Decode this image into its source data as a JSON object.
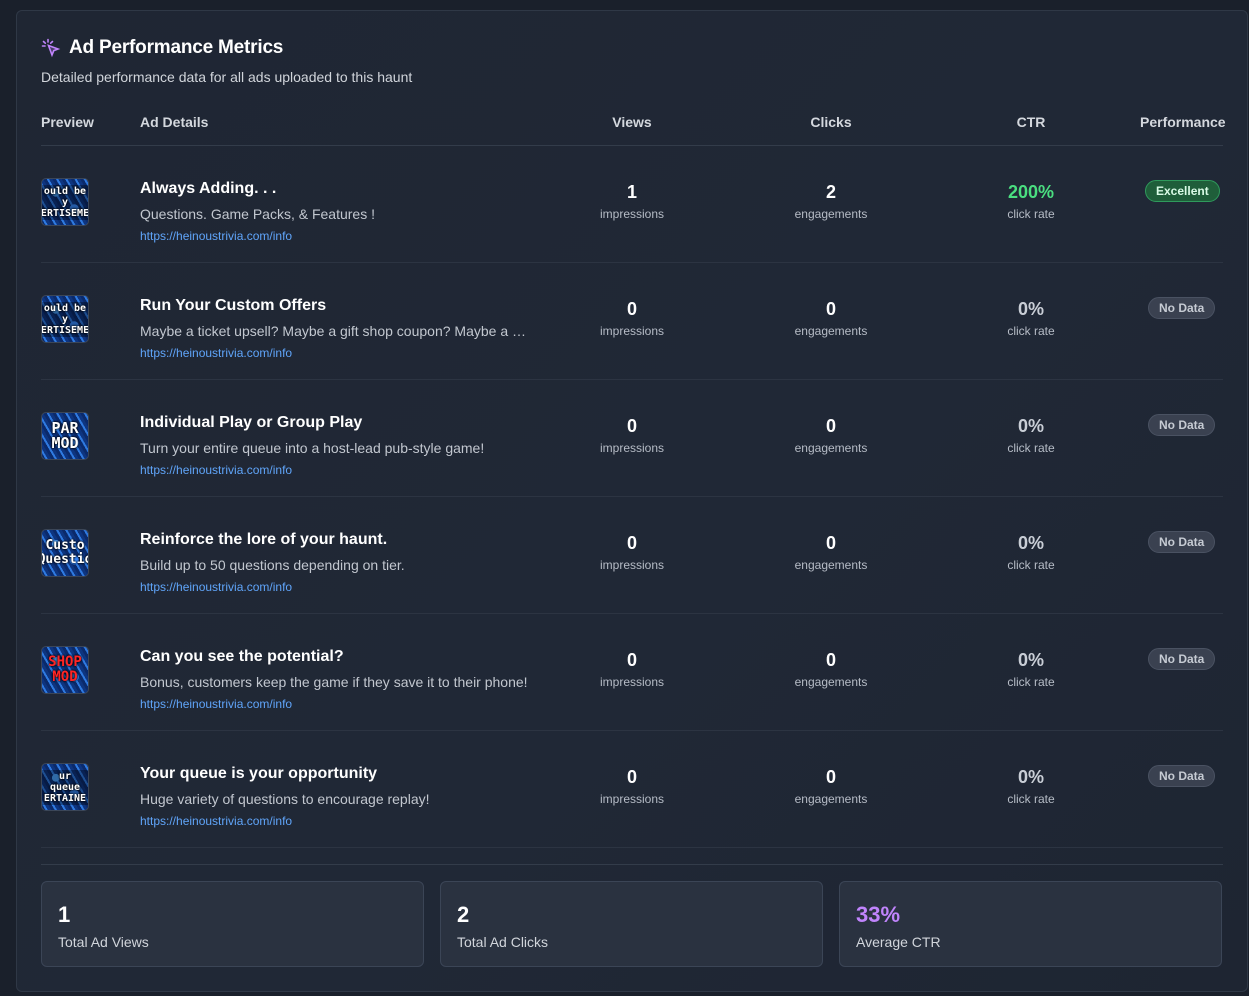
{
  "header": {
    "title": "Ad Performance Metrics",
    "subtitle": "Detailed performance data for all ads uploaded to this haunt",
    "icon": "sparkle-cursor-icon",
    "accent": "#c084fc"
  },
  "table": {
    "columns": [
      "Preview",
      "Ad Details",
      "Views",
      "Clicks",
      "CTR",
      "Performance"
    ],
    "rows": [
      {
        "thumb_text": "ould be y\nERTISEME",
        "title": "Always Adding. . .",
        "description": "Questions. Game Packs, & Features !",
        "link": "https://heinoustrivia.com/info",
        "views": "1",
        "views_label": "impressions",
        "clicks": "2",
        "clicks_label": "engagements",
        "ctr": "200%",
        "ctr_label": "click rate",
        "performance": "Excellent"
      },
      {
        "thumb_text": "ould be y\nERTISEME",
        "title": "Run Your Custom Offers",
        "description": "Maybe a ticket upsell? Maybe a gift shop coupon? Maybe a raffle?",
        "link": "https://heinoustrivia.com/info",
        "views": "0",
        "views_label": "impressions",
        "clicks": "0",
        "clicks_label": "engagements",
        "ctr": "0%",
        "ctr_label": "click rate",
        "performance": "No Data"
      },
      {
        "thumb_text": "PAR\nMOD",
        "title": "Individual Play or Group Play",
        "description": "Turn your entire queue into a host-lead pub-style game!",
        "link": "https://heinoustrivia.com/info",
        "views": "0",
        "views_label": "impressions",
        "clicks": "0",
        "clicks_label": "engagements",
        "ctr": "0%",
        "ctr_label": "click rate",
        "performance": "No Data"
      },
      {
        "thumb_text": "Custo\nQuestio",
        "title": "Reinforce the lore of your haunt.",
        "description": "Build up to 50 questions depending on tier.",
        "link": "https://heinoustrivia.com/info",
        "views": "0",
        "views_label": "impressions",
        "clicks": "0",
        "clicks_label": "engagements",
        "ctr": "0%",
        "ctr_label": "click rate",
        "performance": "No Data"
      },
      {
        "thumb_text": "SHOP\nMOD",
        "title": "Can you see the potential?",
        "description": "Bonus, customers keep the game if they save it to their phone!",
        "link": "https://heinoustrivia.com/info",
        "views": "0",
        "views_label": "impressions",
        "clicks": "0",
        "clicks_label": "engagements",
        "ctr": "0%",
        "ctr_label": "click rate",
        "performance": "No Data"
      },
      {
        "thumb_text": "ur queue\nERTAINE",
        "title": "Your queue is your opportunity",
        "description": "Huge variety of questions to encourage replay!",
        "link": "https://heinoustrivia.com/info",
        "views": "0",
        "views_label": "impressions",
        "clicks": "0",
        "clicks_label": "engagements",
        "ctr": "0%",
        "ctr_label": "click rate",
        "performance": "No Data"
      }
    ]
  },
  "summary": {
    "views_value": "1",
    "views_label": "Total Ad Views",
    "clicks_value": "2",
    "clicks_label": "Total Ad Clicks",
    "ctr_value": "33%",
    "ctr_label": "Average CTR"
  },
  "colors": {
    "excellent": "#4ade80",
    "link": "#60a5fa",
    "ctr_avg": "#c084fc"
  }
}
